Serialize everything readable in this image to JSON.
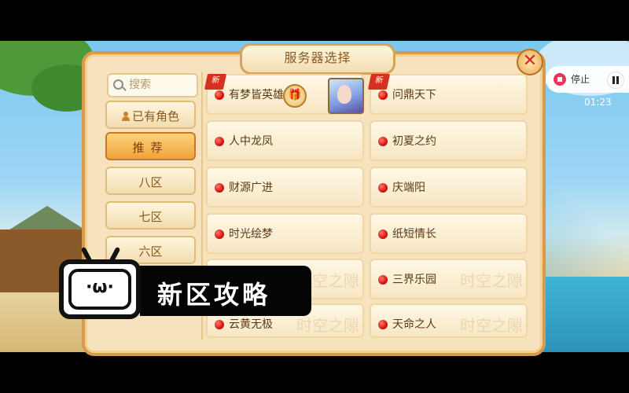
{
  "dialog": {
    "title": "服务器选择",
    "close_label": "✕"
  },
  "search": {
    "placeholder": "搜索"
  },
  "sidebar": {
    "items": [
      {
        "label": "已有角色",
        "active": false
      },
      {
        "label": "推荐",
        "active": true
      },
      {
        "label": "八区",
        "active": false
      },
      {
        "label": "七区",
        "active": false
      },
      {
        "label": "六区",
        "active": false
      }
    ]
  },
  "servers": {
    "left": [
      {
        "name": "有梦皆英雄",
        "status": "red",
        "is_new": true,
        "new_label": "新",
        "has_gift": true
      },
      {
        "name": "人中龙凤",
        "status": "red"
      },
      {
        "name": "财源广进",
        "status": "red"
      },
      {
        "name": "时光绘梦",
        "status": "red"
      },
      {
        "name": "",
        "status": "red",
        "watermark": "时空之隙"
      },
      {
        "name": "云黄无极",
        "status": "red",
        "watermark": "时空之隙"
      }
    ],
    "right": [
      {
        "name": "问鼎天下",
        "status": "red",
        "is_new": true,
        "new_label": "新"
      },
      {
        "name": "初夏之约",
        "status": "red"
      },
      {
        "name": "庆端阳",
        "status": "red"
      },
      {
        "name": "纸短情长",
        "status": "red"
      },
      {
        "name": "三界乐园",
        "status": "red",
        "watermark": "时空之隙"
      },
      {
        "name": "天命之人",
        "status": "red",
        "watermark": "时空之隙"
      }
    ]
  },
  "recorder": {
    "stop_label": "停止",
    "timer": "01:23"
  },
  "overlay": {
    "logo_face": "·ω·",
    "banner_text": "新区攻略"
  },
  "colors": {
    "accent": "#f0a23a",
    "panel_bg": "#f6e3bd",
    "status_red": "#d4160f",
    "new_tag": "#d6301e"
  },
  "icons": [
    "search-icon",
    "person-icon",
    "gift-icon",
    "close-icon",
    "stop-icon",
    "pause-icon"
  ]
}
